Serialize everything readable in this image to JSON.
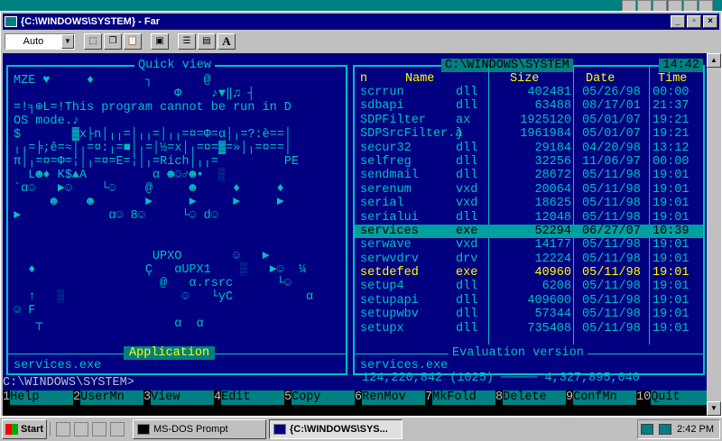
{
  "window": {
    "title": "{C:\\WINDOWS\\SYSTEM} - Far",
    "controls": [
      "_",
      "▫",
      "×"
    ]
  },
  "toolbar": {
    "font_select": "Auto",
    "bold_button": "A"
  },
  "left_panel": {
    "title": "Quick view",
    "viewer_lines": [
      "MZÉ ♥     ♦       ┐       @",
      "                      Φ    ♪▼‖♫ ┤",
      "=!╕⊕L=!This program cannot be run in D",
      "OS mode.♪",
      "$       ▓x├n│╷╷=│╷╷=│╷╷=¤=Φ=α│╷=?:è==│",
      "╷╷=╞;ê=≈│╷=¤:╷=■│╷=│½=x│╷=¤=▓=»│╷=¤==│",
      "π│╷=¤=Φ=╎│╷=¤=E=╎│╷=Rich│╷╷=         PE",
      "  L☻♦ K$▲A         α ☻☺♂☻•  ░         ",
      "`α☺   ►☺    └☺    @     ☻     ♦     ♦",
      "     ☻    ☻       ►     ►     ►     ►",
      "►            α☺ 8☺     └☺ d☺         ",
      "",
      "",
      "                   UPXO       ☺   ►",
      "  ♦               Ç   αUPX1    ░   ►☺  ¼",
      "                    @   α.rsrc      └☺",
      "  ↑   ░                ☺   └yC          α",
      "☺ F                                     ",
      "   ┬                  α  α             "
    ],
    "section_label": "Application",
    "file_name": "services.exe"
  },
  "right_panel": {
    "title": "C:\\WINDOWS\\SYSTEM",
    "clock": "14:42",
    "columns": [
      "n",
      "Name",
      "Size",
      "Date",
      "Time"
    ],
    "rows": [
      {
        "name": "scrrun",
        "ext": "dll",
        "size": "402481",
        "date": "05/26/98",
        "time": "00:00"
      },
      {
        "name": "sdbapi",
        "ext": "dll",
        "size": "63488",
        "date": "08/17/01",
        "time": "21:37"
      },
      {
        "name": "SDPFilter",
        "ext": "ax",
        "size": "1925120",
        "date": "05/01/07",
        "time": "19:21"
      },
      {
        "name": "SDPSrcFilter.a",
        "ext": "}",
        "size": "1961984",
        "date": "05/01/07",
        "time": "19:21"
      },
      {
        "name": "secur32",
        "ext": "dll",
        "size": "29184",
        "date": "04/20/98",
        "time": "13:12"
      },
      {
        "name": "selfreg",
        "ext": "dll",
        "size": "32256",
        "date": "11/06/97",
        "time": "00:00"
      },
      {
        "name": "sendmail",
        "ext": "dll",
        "size": "28672",
        "date": "05/11/98",
        "time": "19:01"
      },
      {
        "name": "serenum",
        "ext": "vxd",
        "size": "20064",
        "date": "05/11/98",
        "time": "19:01"
      },
      {
        "name": "serial",
        "ext": "vxd",
        "size": "18625",
        "date": "05/11/98",
        "time": "19:01"
      },
      {
        "name": "serialui",
        "ext": "dll",
        "size": "12048",
        "date": "05/11/98",
        "time": "19:01"
      },
      {
        "name": "services",
        "ext": "exe",
        "size": "52294",
        "date": "06/27/07",
        "time": "10:39"
      },
      {
        "name": "serwave",
        "ext": "vxd",
        "size": "14177",
        "date": "05/11/98",
        "time": "19:01"
      },
      {
        "name": "serwvdrv",
        "ext": "drv",
        "size": "12224",
        "date": "05/11/98",
        "time": "19:01"
      },
      {
        "name": "setdefed",
        "ext": "exe",
        "size": "40960",
        "date": "05/11/98",
        "time": "19:01"
      },
      {
        "name": "setup4",
        "ext": "dll",
        "size": "6208",
        "date": "05/11/98",
        "time": "19:01"
      },
      {
        "name": "setupapi",
        "ext": "dll",
        "size": "409600",
        "date": "05/11/98",
        "time": "19:01"
      },
      {
        "name": "setupwbv",
        "ext": "dll",
        "size": "57344",
        "date": "05/11/98",
        "time": "19:01"
      },
      {
        "name": "setupx",
        "ext": "dll",
        "size": "735408",
        "date": "05/11/98",
        "time": "19:01"
      }
    ],
    "current_row_index": 10,
    "selected_row_index": 13,
    "status_label": "Evaluation version",
    "file_name": "services.exe",
    "stats": "124,220,842 (1025) ───── 4,327,895,040"
  },
  "command_line": "C:\\WINDOWS\\SYSTEM>",
  "keybar": [
    {
      "num": "1",
      "label": "Help"
    },
    {
      "num": "2",
      "label": "UserMn"
    },
    {
      "num": "3",
      "label": "View"
    },
    {
      "num": "4",
      "label": "Edit"
    },
    {
      "num": "5",
      "label": "Copy"
    },
    {
      "num": "6",
      "label": "RenMov"
    },
    {
      "num": "7",
      "label": "MkFold"
    },
    {
      "num": "8",
      "label": "Delete"
    },
    {
      "num": "9",
      "label": "ConfMn"
    },
    {
      "num": "10",
      "label": "Quit"
    }
  ],
  "taskbar": {
    "start_label": "Start",
    "tasks": [
      {
        "label": "MS-DOS Prompt",
        "active": false
      },
      {
        "label": "{C:\\WINDOWS\\SYS...",
        "active": true
      }
    ],
    "clock": "2:42 PM"
  }
}
